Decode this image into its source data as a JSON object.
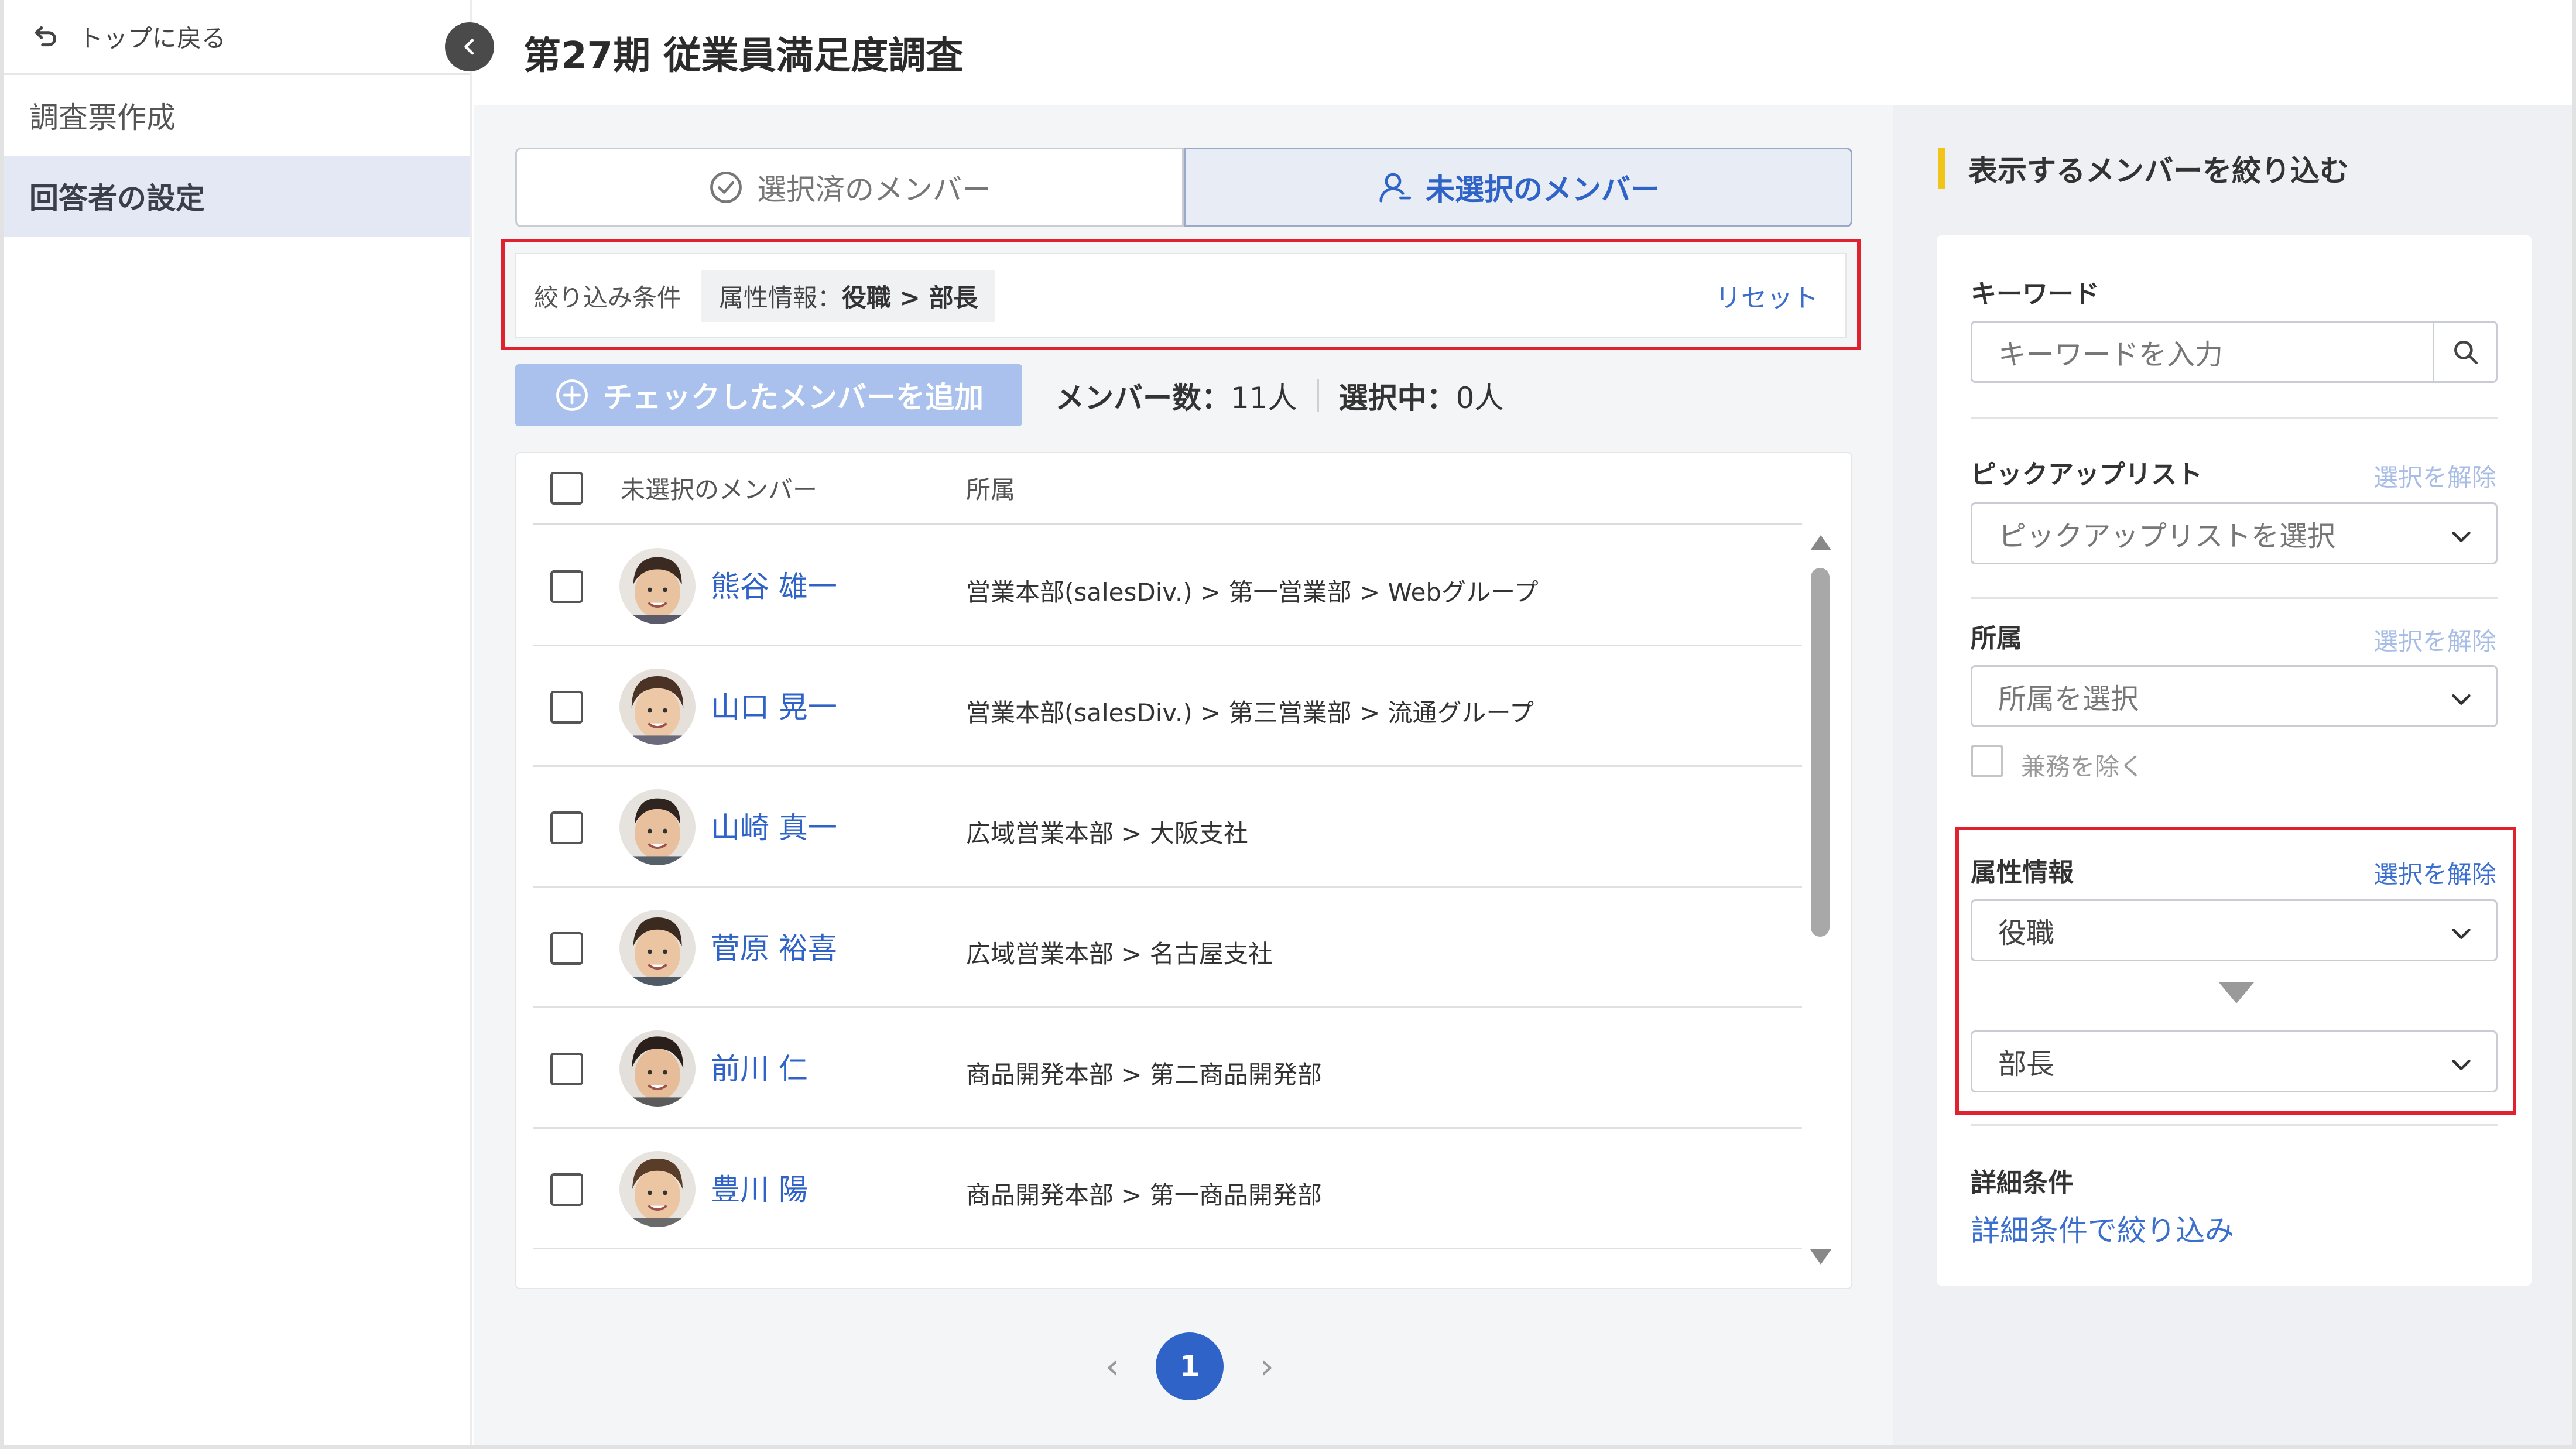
{
  "sidebar": {
    "back_label": "トップに戻る",
    "items": [
      {
        "label": "調査票作成",
        "active": false
      },
      {
        "label": "回答者の設定",
        "active": true
      }
    ]
  },
  "header": {
    "title": "第27期 従業員満足度調査"
  },
  "tabs": [
    {
      "label": "選択済のメンバー",
      "active": false
    },
    {
      "label": "未選択のメンバー",
      "active": true
    }
  ],
  "filter": {
    "label": "絞り込み条件",
    "chip_prefix": "属性情報：",
    "chip_value": "役職 > 部長",
    "reset_label": "リセット"
  },
  "actions": {
    "add_label": "チェックしたメンバーを追加",
    "member_count_label": "メンバー数：",
    "member_count_value": "11人",
    "selected_label": "選択中：",
    "selected_value": "0人"
  },
  "table": {
    "headers": {
      "name": "未選択のメンバー",
      "dept": "所属"
    },
    "rows": [
      {
        "name": "熊谷 雄一",
        "dept": "営業本部(salesDiv.) > 第一営業部 > Webグループ"
      },
      {
        "name": "山口 晃一",
        "dept": "営業本部(salesDiv.) > 第三営業部 > 流通グループ"
      },
      {
        "name": "山崎 真一",
        "dept": "広域営業本部 > 大阪支社"
      },
      {
        "name": "菅原 裕喜",
        "dept": "広域営業本部 > 名古屋支社"
      },
      {
        "name": "前川 仁",
        "dept": "商品開発本部 > 第二商品開発部"
      },
      {
        "name": "豊川 陽",
        "dept": "商品開発本部 > 第一商品開発部"
      }
    ]
  },
  "pagination": {
    "current": "1",
    "prev": "‹",
    "next": "›"
  },
  "panel": {
    "title": "表示するメンバーを絞り込む",
    "keyword": {
      "label": "キーワード",
      "placeholder": "キーワードを入力"
    },
    "picklist": {
      "label": "ピックアップリスト",
      "clear": "選択を解除",
      "placeholder": "ピックアップリストを選択"
    },
    "affiliation": {
      "label": "所属",
      "clear": "選択を解除",
      "placeholder": "所属を選択",
      "exclude_label": "兼務を除く"
    },
    "attribute": {
      "label": "属性情報",
      "clear": "選択を解除",
      "value1": "役職",
      "value2": "部長"
    },
    "detail": {
      "label": "詳細条件",
      "link": "詳細条件で絞り込み"
    }
  },
  "colors": {
    "accent": "#2f63c7",
    "highlight": "#e0212f",
    "title_bar": "#f0c419"
  }
}
